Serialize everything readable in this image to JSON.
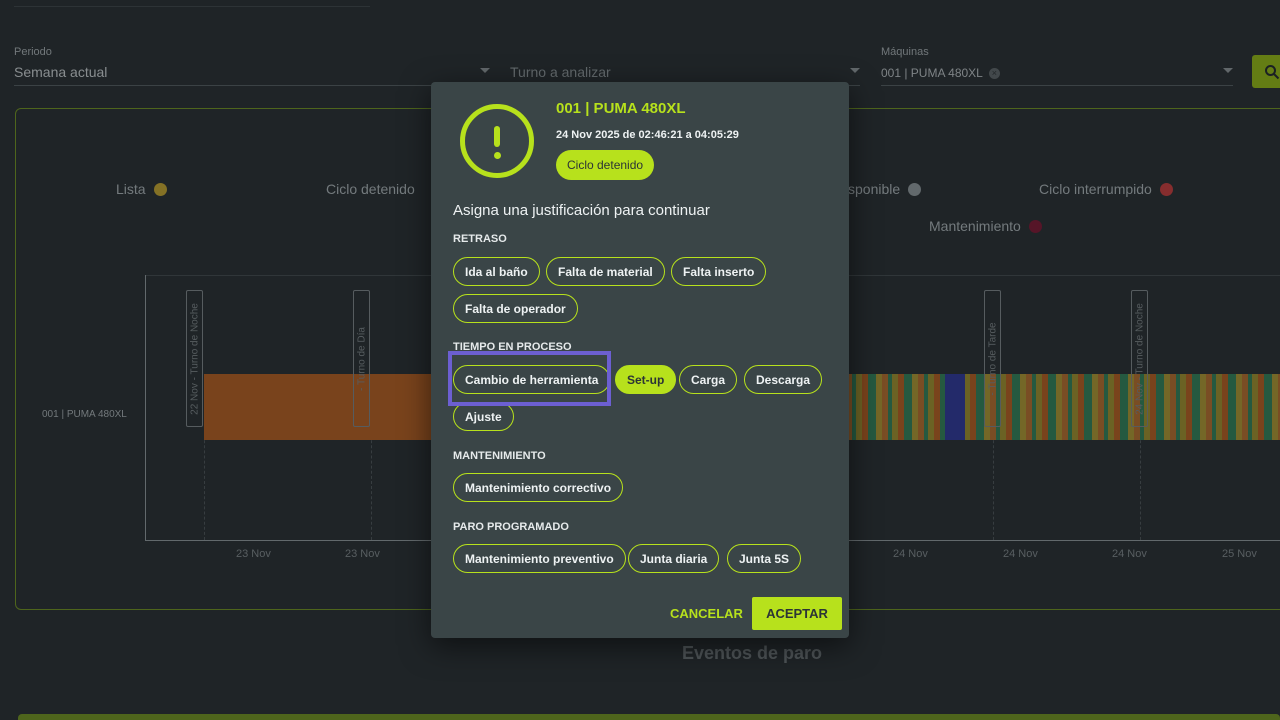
{
  "filters": {
    "period": {
      "label": "Periodo",
      "value": "Semana actual"
    },
    "shift": {
      "placeholder": "Turno a analizar"
    },
    "machines": {
      "label": "Máquinas",
      "chip": "001 | PUMA 480XL"
    }
  },
  "legend": [
    {
      "label": "Lista",
      "color": "#c1a22b"
    },
    {
      "label": "Ciclo detenido",
      "color": "#b7e11c"
    },
    {
      "label": "sponible",
      "color": "#8d9598"
    },
    {
      "label": "Ciclo interrumpido",
      "color": "#c33a3a"
    },
    {
      "label": "Mantenimiento",
      "color": "#7a1430"
    }
  ],
  "chart": {
    "row_label": "001 | PUMA 480XL",
    "shift_labels": [
      "22 Nov - Turno de Noche",
      "- Turno de Día",
      "- Turno de Tarde",
      "24 Nov - Turno de Noche"
    ],
    "ticks": [
      "23 Nov",
      "23 Nov",
      "24 Nov",
      "24 Nov",
      "24 Nov",
      "25 Nov"
    ]
  },
  "section_title": "Eventos de paro",
  "dialog": {
    "machine": "001 | PUMA 480XL",
    "date_range": "24 Nov 2025 de 02:46:21 a 04:05:29",
    "status": "Ciclo detenido",
    "heading": "Asigna una justificación para continuar",
    "categories": {
      "retraso": {
        "title": "RETRASO",
        "options": [
          "Ida al baño",
          "Falta de material",
          "Falta inserto",
          "Falta de operador"
        ]
      },
      "proceso": {
        "title": "TIEMPO EN PROCESO",
        "options": [
          "Cambio de herramienta",
          "Set-up",
          "Carga",
          "Descarga",
          "Ajuste"
        ]
      },
      "mantenimiento": {
        "title": "MANTENIMIENTO",
        "options": [
          "Mantenimiento correctivo"
        ]
      },
      "paro": {
        "title": "PARO PROGRAMADO",
        "options": [
          "Mantenimiento preventivo",
          "Junta diaria",
          "Junta 5S"
        ]
      }
    },
    "selected_option": "Set-up",
    "cancel_label": "CANCELAR",
    "accept_label": "ACEPTAR"
  }
}
